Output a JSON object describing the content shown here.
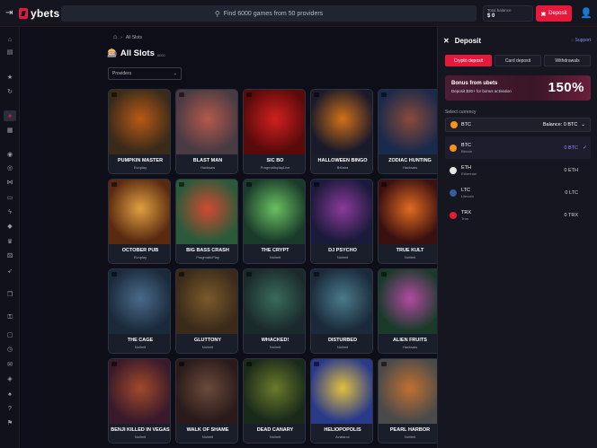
{
  "header": {
    "brand": "ybets",
    "search_placeholder": "Find 6000 games from 50 providers",
    "balance_label": "Total balance",
    "balance_value": "$ 0",
    "deposit_label": "Deposit"
  },
  "breadcrumb": {
    "current": "All Slots"
  },
  "page": {
    "title": "All Slots",
    "count": "6000",
    "provider_select": "Providers"
  },
  "games": [
    {
      "name": "PUMPKIN MASTER",
      "provider": "Evoplay",
      "colors": [
        "#3a2a1a",
        "#b85a14"
      ]
    },
    {
      "name": "BLAST MAN",
      "provider": "Hacksaw",
      "colors": [
        "#4a3a44",
        "#b25a4a"
      ]
    },
    {
      "name": "SIC BO",
      "provider": "PragmaticplayLive",
      "colors": [
        "#5a0a0a",
        "#d02020"
      ]
    },
    {
      "name": "HALLOWEEN BINGO",
      "provider": "Belatra",
      "colors": [
        "#1a1a2a",
        "#d07018"
      ]
    },
    {
      "name": "ZODIAC HUNTING",
      "provider": "Hacksaw",
      "colors": [
        "#1a2a4a",
        "#8a4a3a"
      ]
    },
    {
      "name": "OCTOBER PUB",
      "provider": "Evoplay",
      "colors": [
        "#5a2a10",
        "#e0a040"
      ]
    },
    {
      "name": "BIG BASS CRASH",
      "provider": "PragmaticPlay",
      "colors": [
        "#2a5a3a",
        "#d04a30"
      ]
    },
    {
      "name": "THE CRYPT",
      "provider": "Nolimit",
      "colors": [
        "#1a3a2a",
        "#6ac060"
      ]
    },
    {
      "name": "DJ PSYCHO",
      "provider": "Nolimit",
      "colors": [
        "#1a1a3a",
        "#8a3a9a"
      ]
    },
    {
      "name": "TRUE KULT",
      "provider": "Nolimit",
      "colors": [
        "#3a1010",
        "#e06a20"
      ]
    },
    {
      "name": "THE CAGE",
      "provider": "Nolimit",
      "colors": [
        "#1a2a3a",
        "#4a6a8a"
      ]
    },
    {
      "name": "GLUTTONY",
      "provider": "Nolimit",
      "colors": [
        "#3a2a1a",
        "#7a5a2a"
      ]
    },
    {
      "name": "WHACKED!",
      "provider": "Nolimit",
      "colors": [
        "#1a2a2a",
        "#3a6a5a"
      ]
    },
    {
      "name": "DISTURBED",
      "provider": "Nolimit",
      "colors": [
        "#1a2a3a",
        "#4a7a8a"
      ]
    },
    {
      "name": "ALIEN FRUITS",
      "provider": "Hacksaw",
      "colors": [
        "#1a3a2a",
        "#b04aa0"
      ]
    },
    {
      "name": "BENJI KILLED IN VEGAS",
      "provider": "Nolimit",
      "colors": [
        "#3a1a2a",
        "#a04a2a"
      ]
    },
    {
      "name": "WALK OF SHAME",
      "provider": "Nolimit",
      "colors": [
        "#2a1a1a",
        "#6a4a3a"
      ]
    },
    {
      "name": "DEAD CANARY",
      "provider": "Nolimit",
      "colors": [
        "#1a2a1a",
        "#6a7a2a"
      ]
    },
    {
      "name": "HELIOPOPOLIS",
      "provider": "Avatarux",
      "colors": [
        "#2a3a8a",
        "#e0c040"
      ]
    },
    {
      "name": "PEARL HARBOR",
      "provider": "Nolimit",
      "colors": [
        "#4a4a4a",
        "#c07030"
      ]
    }
  ],
  "deposit_panel": {
    "title": "Deposit",
    "support": "Support",
    "tabs": [
      "Crypto deposit",
      "Card deposit",
      "Withdrawals"
    ],
    "bonus_title": "Bonus from ubets",
    "bonus_sub": "Deposit $30+ for bonus activation",
    "bonus_pct": "150%",
    "select_label": "Select currency",
    "selected_symbol": "BTC",
    "selected_balance": "Balance: 0 BTC",
    "currencies": [
      {
        "symbol": "BTC",
        "name": "Bitcoin",
        "amount": "0 BTC",
        "color": "#f7931a"
      },
      {
        "symbol": "ETH",
        "name": "Ethereum",
        "amount": "0 ETH",
        "color": "#e8e8e8"
      },
      {
        "symbol": "LTC",
        "name": "Litecoin",
        "amount": "0 LTC",
        "color": "#345d9d"
      },
      {
        "symbol": "TRX",
        "name": "Tron",
        "amount": "0 TRX",
        "color": "#e6193c"
      }
    ]
  }
}
